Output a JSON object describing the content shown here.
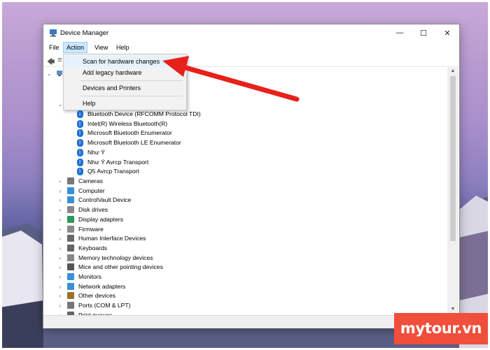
{
  "window": {
    "title": "Device Manager",
    "controls": {
      "minimize": "—",
      "maximize": "☐",
      "close": "✕"
    }
  },
  "menubar": [
    "File",
    "Action",
    "View",
    "Help"
  ],
  "action_menu": {
    "items": [
      "Scan for hardware changes",
      "Add legacy hardware",
      "Devices and Printers",
      "Help"
    ]
  },
  "tree": {
    "bluetooth_devices": [
      "Bluetooth Device (RFCOMM Protocol TDI)",
      "Intel(R) Wireless Bluetooth(R)",
      "Microsoft Bluetooth Enumerator",
      "Microsoft Bluetooth LE Enumerator",
      "Như Ý",
      "Như Ý Avrcp Transport",
      "Q5 Avrcp Transport"
    ],
    "categories": [
      "Cameras",
      "Computer",
      "ControlVault Device",
      "Disk drives",
      "Display adapters",
      "Firmware",
      "Human Interface Devices",
      "Keyboards",
      "Memory technology devices",
      "Mice and other pointing devices",
      "Monitors",
      "Network adapters",
      "Other devices",
      "Ports (COM & LPT)",
      "Print queues"
    ]
  },
  "watermark": "mytour.vn",
  "colors": {
    "arrow": "#e8201a",
    "watermark_bg": "#f04f3c",
    "menu_highlight": "#cce8ff",
    "bluetooth": "#1d6fd6"
  }
}
